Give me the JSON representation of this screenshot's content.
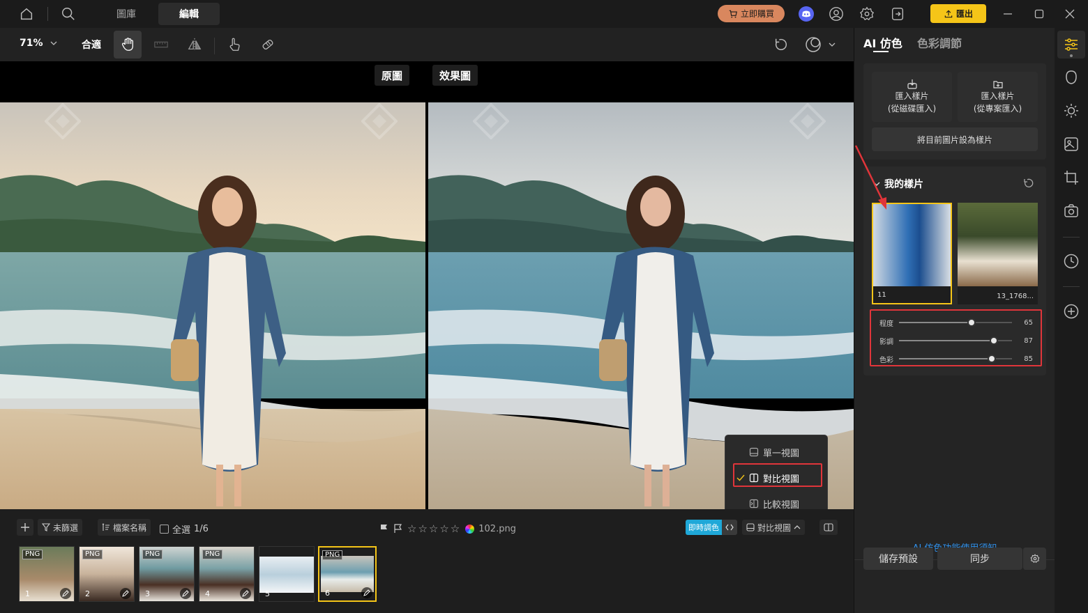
{
  "nav": {
    "tab_library": "圖庫",
    "tab_edit": "編輯",
    "buy_label": "立即購買",
    "export_label": "匯出"
  },
  "toolbar": {
    "zoom": "71%",
    "fit_label": "合適"
  },
  "canvas": {
    "original_label": "原圖",
    "result_label": "效果圖"
  },
  "view_menu": {
    "items": [
      "單一視圖",
      "對比視圖",
      "比較視圖"
    ],
    "selected": "對比視圖"
  },
  "filmstrip": {
    "unfiltered": "未篩選",
    "sort_by": "檔案名稱",
    "select_all": "全選",
    "count": "1/6",
    "filename": "102.png",
    "live_color": "即時調色",
    "compare_view": "對比視圖",
    "thumbs": [
      {
        "num": "1",
        "badge": "PNG"
      },
      {
        "num": "2",
        "badge": "PNG"
      },
      {
        "num": "3",
        "badge": "PNG"
      },
      {
        "num": "4",
        "badge": "PNG"
      },
      {
        "num": "5",
        "badge": ""
      },
      {
        "num": "6",
        "badge": "PNG"
      }
    ]
  },
  "panel": {
    "tab_ai": "AI 仿色",
    "tab_color": "色彩調節",
    "import_disk_1": "匯入樣片",
    "import_disk_2": "(從磁碟匯入)",
    "import_proj_1": "匯入樣片",
    "import_proj_2": "(從專案匯入)",
    "set_current": "將目前圖片設為樣片",
    "my_samples": "我的樣片",
    "samples": [
      {
        "name": "11"
      },
      {
        "name": "13_1768..."
      }
    ],
    "sliders": [
      {
        "label": "程度",
        "value": 65,
        "pct": 0.64
      },
      {
        "label": "影調",
        "value": 87,
        "pct": 0.84
      },
      {
        "label": "色彩",
        "value": 85,
        "pct": 0.82
      }
    ],
    "help_link": "AI 仿色功能使用須知",
    "save_preset": "儲存預設",
    "sync": "同步"
  },
  "colors": {
    "accent": "#f5c518",
    "buy": "#d9875e",
    "live": "#1fa8d8",
    "highlight_red": "#e0353a",
    "link_blue": "#2f8fe8"
  }
}
